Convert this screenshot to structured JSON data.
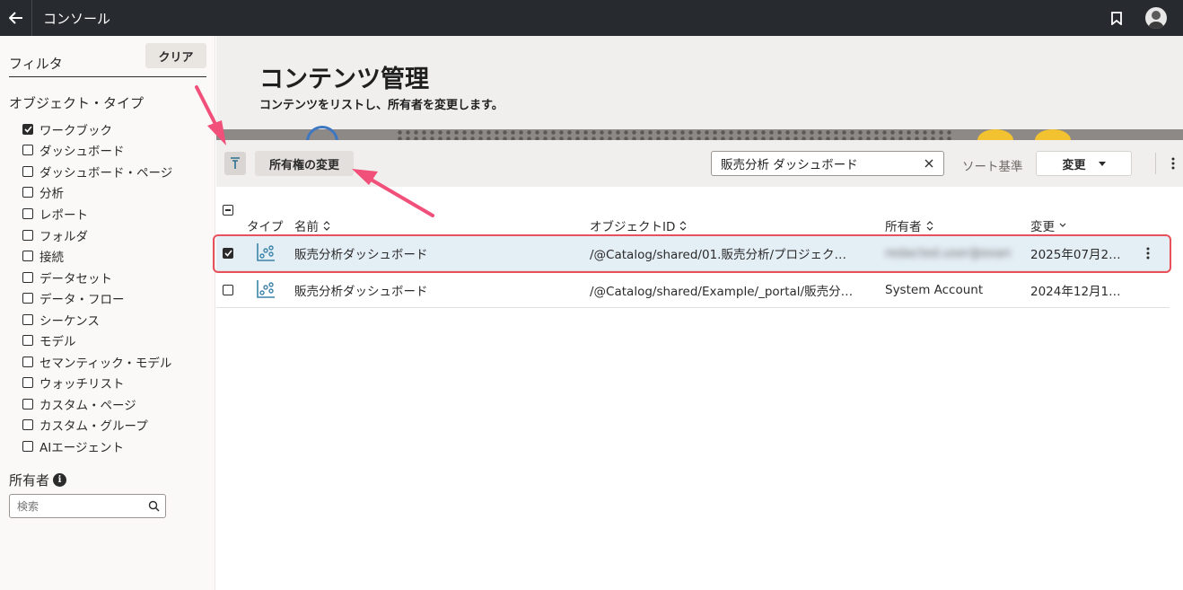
{
  "topbar": {
    "title": "コンソール"
  },
  "sidebar": {
    "filter_title": "フィルタ",
    "clear_label": "クリア",
    "object_type_title": "オブジェクト・タイプ",
    "types": [
      {
        "label": "ワークブック",
        "checked": true
      },
      {
        "label": "ダッシュボード",
        "checked": false
      },
      {
        "label": "ダッシュボード・ページ",
        "checked": false
      },
      {
        "label": "分析",
        "checked": false
      },
      {
        "label": "レポート",
        "checked": false
      },
      {
        "label": "フォルダ",
        "checked": false
      },
      {
        "label": "接続",
        "checked": false
      },
      {
        "label": "データセット",
        "checked": false
      },
      {
        "label": "データ・フロー",
        "checked": false
      },
      {
        "label": "シーケンス",
        "checked": false
      },
      {
        "label": "モデル",
        "checked": false
      },
      {
        "label": "セマンティック・モデル",
        "checked": false
      },
      {
        "label": "ウォッチリスト",
        "checked": false
      },
      {
        "label": "カスタム・ページ",
        "checked": false
      },
      {
        "label": "カスタム・グループ",
        "checked": false
      },
      {
        "label": "AIエージェント",
        "checked": false
      }
    ],
    "owner_title": "所有者",
    "owner_search_placeholder": "検索"
  },
  "header": {
    "title": "コンテンツ管理",
    "subtitle": "コンテンツをリストし、所有者を変更します。"
  },
  "toolbar": {
    "change_owner_label": "所有権の変更",
    "search_value": "販売分析 ダッシュボード",
    "sort_label": "ソート基準",
    "sort_value": "変更"
  },
  "table": {
    "columns": {
      "type": "タイプ",
      "name": "名前",
      "object_id": "オブジェクトID",
      "owner": "所有者",
      "modified": "変更"
    },
    "rows": [
      {
        "checked": true,
        "name": "販売分析ダッシュボード",
        "object_id": "/@Catalog/shared/01.販売分析/プロジェク…",
        "owner": "redacted.user@example",
        "modified": "2025年07月2…"
      },
      {
        "checked": false,
        "name": "販売分析ダッシュボード",
        "object_id": "/@Catalog/shared/Example/_portal/販売分…",
        "owner": "System Account",
        "modified": "2024年12月1…"
      }
    ]
  },
  "colors": {
    "topbar": "#272b2f",
    "selected_row": "#e4eef5",
    "annotation": "#f0507a",
    "workbook_icon": "#3a83a8"
  }
}
